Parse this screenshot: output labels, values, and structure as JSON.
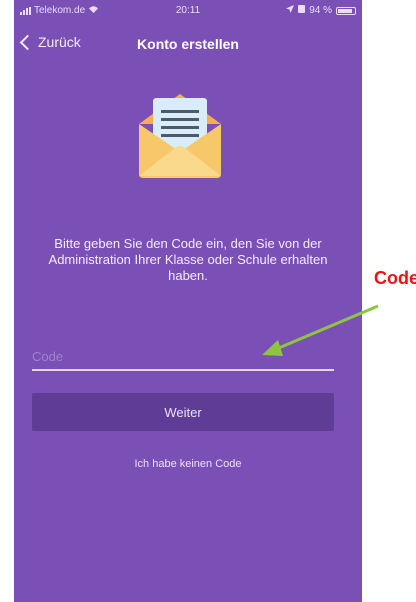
{
  "status_bar": {
    "carrier": "Telekom.de",
    "time": "20:11",
    "battery": "94 %"
  },
  "nav": {
    "back_label": "Zurück",
    "title": "Konto erstellen"
  },
  "instruction": "Bitte geben Sie den Code ein, den Sie von der Administration Ihrer Klasse oder Schule erhalten haben.",
  "code_field": {
    "placeholder": "Code",
    "value": ""
  },
  "continue_button": "Weiter",
  "no_code_link": "Ich habe keinen Code",
  "annotation": {
    "label": "Code"
  },
  "colors": {
    "background": "#7b50b6",
    "button": "#5f3c96",
    "envelope": "#f7c86a",
    "envelope_flap": "#f2b04d",
    "letter": "#d8ecfa",
    "annotation_label": "#ee1111",
    "annotation_arrow": "#8cc63f"
  },
  "icons": {
    "envelope": "open-envelope-letter",
    "back": "chevron-left",
    "signal": "cellular-signal",
    "wifi": "wifi",
    "location": "location-arrow",
    "battery": "battery"
  }
}
